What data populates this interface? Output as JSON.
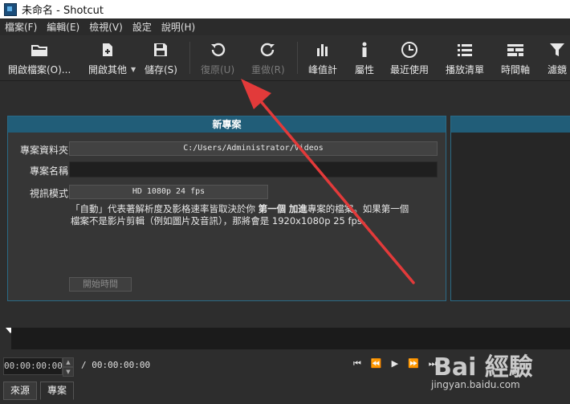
{
  "window": {
    "title": "未命名 - Shotcut"
  },
  "menu": [
    "檔案(F)",
    "編輯(E)",
    "檢視(V)",
    "設定",
    "說明(H)"
  ],
  "toolbar": {
    "open_file": "開啟檔案(O)...",
    "open_other": "開啟其他",
    "save": "儲存(S)",
    "undo": "復原(U)",
    "redo": "重做(R)",
    "peak_meter": "峰值計",
    "properties": "屬性",
    "recent": "最近使用",
    "playlist": "播放清單",
    "timeline": "時間軸",
    "filters": "濾鏡"
  },
  "new_project": {
    "header": "新專案",
    "folder_label": "專案資料夾",
    "folder_value": "C:/Users/Administrator/Videos",
    "name_label": "專案名稱",
    "name_value": "",
    "video_mode_label": "視訊模式",
    "video_mode_value": "HD 1080p 24 fps",
    "desc_1": "「自動」代表著解析度及影格速率皆取決於你",
    "desc_bold_1": "第一個",
    "desc_bold_2": "加進",
    "desc_2": "專案的檔案。如果第一個",
    "desc_3": "檔案不是影片剪輯（例如圖片及音訊），那將會是 1920x1080p 25 fps。",
    "start_button": "開始時間"
  },
  "player": {
    "position": "00:00:00:00",
    "duration": "/ 00:00:00:00"
  },
  "tabs": [
    "來源",
    "專案"
  ],
  "watermark": {
    "text": "jingyan.baidu.com",
    "brand": "Bai 經驗"
  },
  "colors": {
    "accent": "#215d78",
    "arrow": "#e23a3a"
  }
}
